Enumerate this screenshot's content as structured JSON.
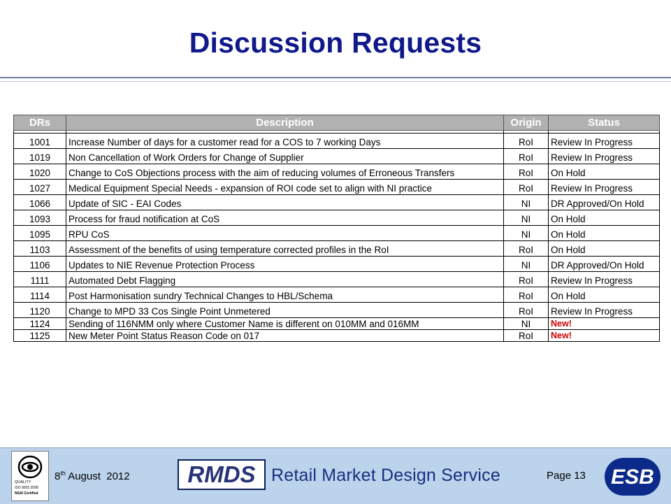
{
  "slide": {
    "title": "Discussion Requests"
  },
  "table": {
    "headers": {
      "drs": "DRs",
      "description": "Description",
      "origin": "Origin",
      "status": "Status"
    },
    "rows": [
      {
        "id": "1001",
        "description": "Increase Number of days for a customer read for a COS to 7 working Days",
        "origin": "RoI",
        "status": "Review In Progress"
      },
      {
        "id": "1019",
        "description": "Non Cancellation of Work Orders for Change of Supplier",
        "origin": "RoI",
        "status": "Review In Progress"
      },
      {
        "id": "1020",
        "description": "Change to CoS Objections process with the aim of reducing volumes of Erroneous Transfers",
        "origin": "RoI",
        "status": "On Hold"
      },
      {
        "id": "1027",
        "description": "Medical Equipment Special Needs - expansion of ROI code set to align with NI practice",
        "origin": "RoI",
        "status": "Review In Progress"
      },
      {
        "id": "1066",
        "description": "Update of SIC - EAI Codes",
        "origin": "NI",
        "status": "DR Approved/On Hold"
      },
      {
        "id": "1093",
        "description": "Process for fraud notification at CoS",
        "origin": "NI",
        "status": "On Hold"
      },
      {
        "id": "1095",
        "description": "RPU CoS",
        "origin": "NI",
        "status": "On Hold"
      },
      {
        "id": "1103",
        "description": "Assessment of the benefits of using temperature corrected profiles in the RoI",
        "origin": "RoI",
        "status": "On Hold"
      },
      {
        "id": "1106",
        "description": "Updates to NIE Revenue Protection Process",
        "origin": "NI",
        "status": "DR Approved/On Hold"
      },
      {
        "id": "1111",
        "description": "Automated Debt Flagging",
        "origin": "RoI",
        "status": "Review In Progress"
      },
      {
        "id": "1114",
        "description": "Post Harmonisation sundry Technical Changes to HBL/Schema",
        "origin": "RoI",
        "status": "On Hold"
      },
      {
        "id": "1120",
        "description": "Change to MPD 33 Cos Single Point Unmetered",
        "origin": "RoI",
        "status": "Review In Progress"
      },
      {
        "id": "1124",
        "description": "Sending of 116NMM only where Customer Name is different on 010MM and 016MM",
        "origin": "NI",
        "status": "New!"
      },
      {
        "id": "1125",
        "description": "New Meter Point Status Reason Code on 017",
        "origin": "RoI",
        "status": "New!"
      }
    ],
    "new_status_color": "#cc0000",
    "header_bg": "#b1b1b1"
  },
  "footer": {
    "quality_badge": {
      "line1": "QUALITY",
      "line2": "ISO 9001:2008",
      "line3": "NSAI Certified",
      "icon": "nsai-quality-mark-icon"
    },
    "date_day": "8",
    "date_suffix": "th",
    "date_rest": " August  2012",
    "rmds_logo": "RMDS",
    "service_name": "Retail Market Design Service",
    "page_label": "Page 13",
    "esb_logo": "ESB",
    "bg_color": "#bcd3ec"
  }
}
